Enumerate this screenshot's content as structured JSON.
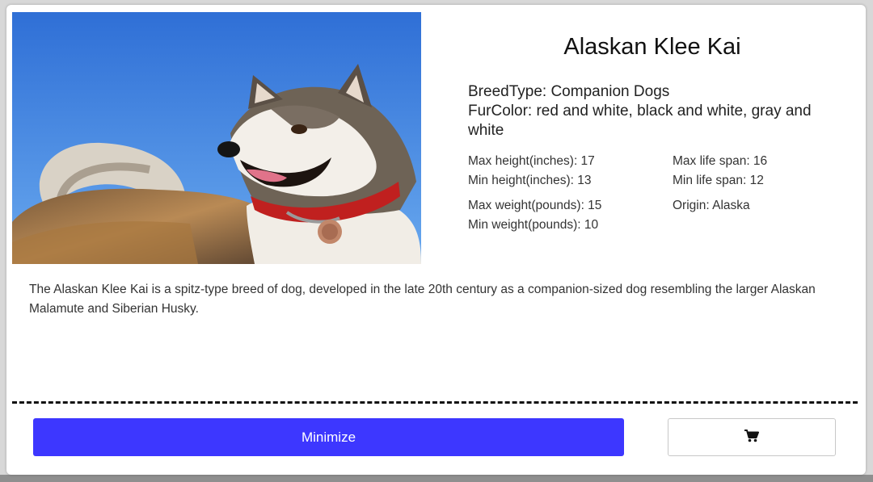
{
  "breed": {
    "name": "Alaskan Klee Kai",
    "breed_type": "BreedType: Companion Dogs",
    "fur_color": "FurColor: red and white, black and white, gray and white",
    "max_height": "Max height(inches): 17",
    "min_height": "Min height(inches): 13",
    "max_weight": "Max weight(pounds): 15",
    "min_weight": "Min weight(pounds): 10",
    "max_life_span": "Max life span: 16",
    "min_life_span": "Min life span: 12",
    "origin": "Origin: Alaska",
    "description": "The Alaskan Klee Kai is a spitz-type breed of dog, developed in the late 20th century as a companion-sized dog resembling the larger Alaskan Malamute and Siberian Husky."
  },
  "actions": {
    "minimize_label": "Minimize",
    "cart_icon": "shopping-cart-icon"
  },
  "colors": {
    "primary": "#3d37ff",
    "sky": "#3f86e0",
    "divider": "#111111"
  }
}
